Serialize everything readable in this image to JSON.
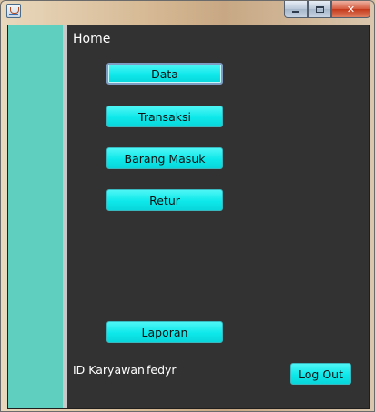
{
  "window": {
    "title": ""
  },
  "main": {
    "title": "Home",
    "menu_buttons": {
      "data": "Data",
      "transaksi": "Transaksi",
      "barang_masuk": "Barang Masuk",
      "retur": "Retur",
      "laporan": "Laporan"
    },
    "employee": {
      "label": "ID Karyawan",
      "value": "fedyr"
    },
    "logout_label": "Log Out"
  },
  "colors": {
    "sidebar": "#5fcfbf",
    "background": "#323232",
    "button": "#0ee8ea"
  }
}
